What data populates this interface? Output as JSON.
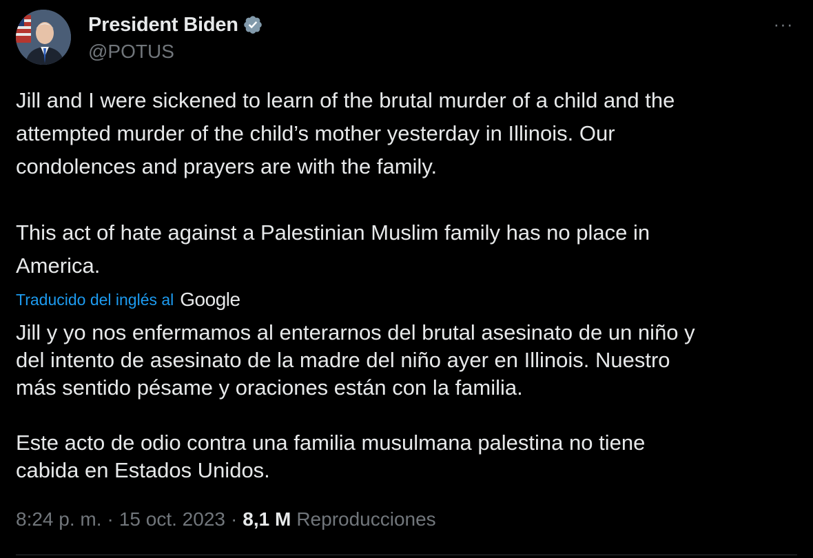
{
  "author": {
    "display_name": "President Biden",
    "handle": "@POTUS",
    "verified_icon": "verified-badge-icon",
    "avatar_icon": "avatar"
  },
  "more_icon": "more-horizontal-icon",
  "more_label": "···",
  "tweet": {
    "paragraph_1": "Jill and I were sickened to learn of the brutal murder of a child and the\nattempted murder of the child’s mother yesterday in Illinois. Our\ncondolences and prayers are with the family.",
    "paragraph_2": "This act of hate against a Palestinian Muslim family has no place in\nAmerica."
  },
  "translation": {
    "label": "Traducido del inglés al",
    "provider": "Google",
    "paragraph_1": "Jill y yo nos enfermamos al enterarnos del brutal asesinato de un niño y\ndel intento de asesinato de la madre del niño ayer en Illinois. Nuestro\nmás sentido pésame y oraciones están con la familia.",
    "paragraph_2": "Este acto de odio contra una familia musulmana palestina no tiene\ncabida en Estados Unidos."
  },
  "meta": {
    "time": "8:24 p. m.",
    "separator": "·",
    "date": "15 oct. 2023",
    "views_count": "8,1 M",
    "views_label": "Reproducciones"
  },
  "colors": {
    "background": "#000000",
    "text": "#e7e9ea",
    "secondary": "#71767b",
    "link": "#1d9bf0",
    "divider": "#2f3336"
  }
}
